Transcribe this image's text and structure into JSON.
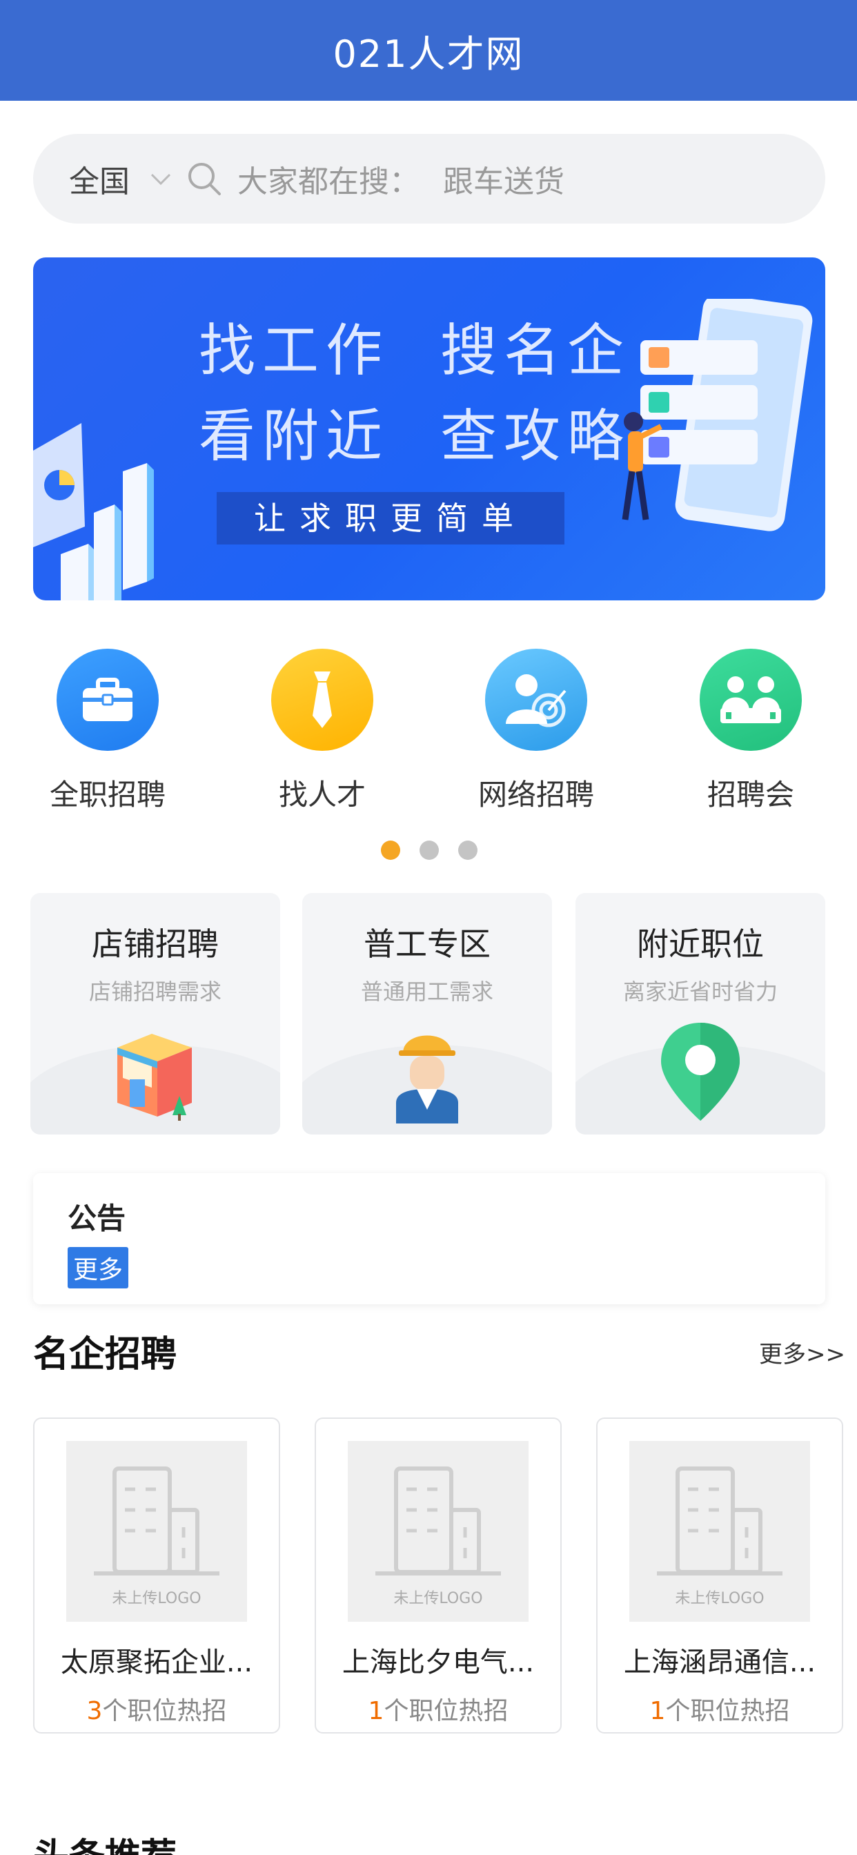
{
  "header": {
    "title": "021人才网"
  },
  "search": {
    "region": "全国",
    "placeholder": "大家都在搜：",
    "hot_keyword": "跟车送货"
  },
  "banner": {
    "line1_a": "找工作",
    "line1_b": "搜名企",
    "line2_a": "看附近",
    "line2_b": "查攻略",
    "slogan": "让求职更简单"
  },
  "categories": [
    {
      "label": "全职招聘",
      "icon": "briefcase-icon",
      "color": "#2e8ef5"
    },
    {
      "label": "找人才",
      "icon": "tie-icon",
      "color": "#ffc107"
    },
    {
      "label": "网络招聘",
      "icon": "user-target-icon",
      "color": "#3fa6f0"
    },
    {
      "label": "招聘会",
      "icon": "meeting-icon",
      "color": "#2fcf8c"
    }
  ],
  "pager": {
    "pages": 3,
    "active": 1
  },
  "feature_cards": [
    {
      "title": "店铺招聘",
      "subtitle": "店铺招聘需求",
      "icon": "shop-icon"
    },
    {
      "title": "普工专区",
      "subtitle": "普通用工需求",
      "icon": "worker-icon"
    },
    {
      "title": "附近职位",
      "subtitle": "离家近省时省力",
      "icon": "location-pin-icon"
    }
  ],
  "notice": {
    "title": "公告",
    "more": "更多"
  },
  "famous": {
    "title": "名企招聘",
    "more": "更多>>",
    "logo_placeholder": "未上传LOGO",
    "jobs_suffix": "个职位热招",
    "companies": [
      {
        "name": "太原聚拓企业...",
        "count": "3"
      },
      {
        "name": "上海比夕电气...",
        "count": "1"
      },
      {
        "name": "上海涵昂通信...",
        "count": "1"
      }
    ]
  },
  "next_section": {
    "title": "头条推荐"
  }
}
